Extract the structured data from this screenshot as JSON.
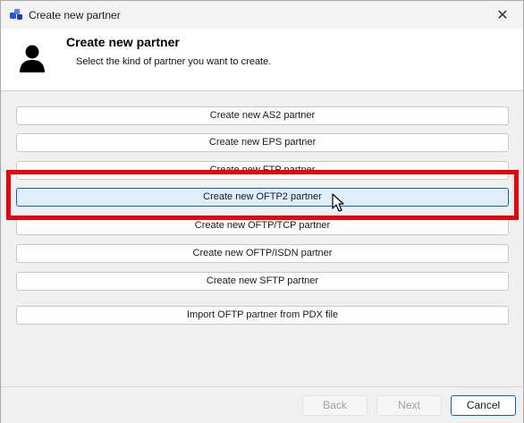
{
  "window": {
    "title": "Create new partner",
    "close_glyph": "✕"
  },
  "header": {
    "title": "Create new partner",
    "subtitle": "Select the kind of partner you want to create.",
    "icon": "user-icon"
  },
  "options": [
    {
      "label": "Create new AS2 partner"
    },
    {
      "label": "Create new EPS partner"
    },
    {
      "label": "Create new FTP partner"
    },
    {
      "label": "Create new OFTP2 partner"
    },
    {
      "label": "Create new OFTP/TCP partner"
    },
    {
      "label": "Create new OFTP/ISDN partner"
    },
    {
      "label": "Create new SFTP partner"
    },
    {
      "label": "Import OFTP partner from PDX file"
    }
  ],
  "highlighted_option": "Create new OFTP2 partner",
  "footer": {
    "back_label": "Back",
    "next_label": "Next",
    "cancel_label": "Cancel"
  },
  "colors": {
    "highlight": "#e6000b",
    "accent": "#0067c0"
  }
}
